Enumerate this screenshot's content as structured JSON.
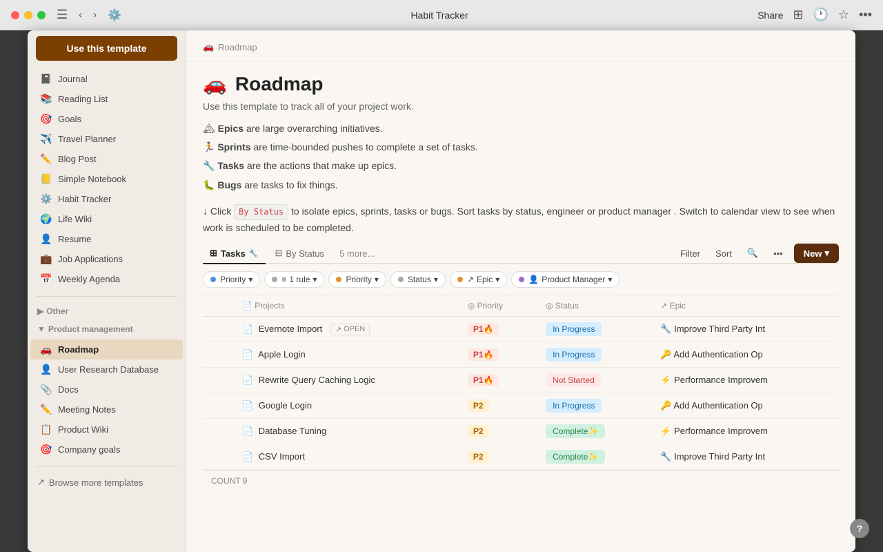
{
  "titlebar": {
    "title": "Habit Tracker",
    "share_label": "Share",
    "dots": [
      "red",
      "yellow",
      "green"
    ]
  },
  "use_template_btn": "Use this template",
  "breadcrumb": {
    "icon": "🚗",
    "label": "Roadmap"
  },
  "page": {
    "title": "Roadmap",
    "title_icon": "🚗",
    "description": "Use this template to track all of your project work.",
    "body_lines": [
      {
        "term": "Epics",
        "text": " are large overarching initiatives."
      },
      {
        "term": "Sprints",
        "text": " are time-bounded pushes to complete a set of tasks."
      },
      {
        "term": "Tasks",
        "text": " are the actions that make up epics."
      },
      {
        "term": "Bugs",
        "text": " are tasks to fix things."
      }
    ],
    "instruction": " Click ",
    "status_badge": "By Status",
    "instruction_after": " to isolate epics, sprints, tasks or bugs. Sort tasks by status, engineer or product manager . Switch to calendar view to see when work is scheduled to be completed."
  },
  "tabs": [
    {
      "label": "Tasks",
      "icon": "⊞",
      "active": true
    },
    {
      "label": "By Status",
      "icon": "⊟",
      "active": false
    }
  ],
  "tabs_more": "5 more...",
  "tabs_actions": {
    "filter": "Filter",
    "sort": "Sort",
    "search_icon": "🔍",
    "more_icon": "...",
    "new_btn": "New"
  },
  "filters": [
    {
      "label": "Priority",
      "icon": "↑",
      "type": "blue"
    },
    {
      "label": "1 rule",
      "icon": "≡",
      "type": "gray"
    },
    {
      "label": "Priority",
      "icon": "",
      "type": "orange"
    },
    {
      "label": "Status",
      "icon": "",
      "type": "gray"
    },
    {
      "label": "Epic",
      "icon": "↗",
      "type": "orange"
    },
    {
      "label": "Product Manager",
      "icon": "",
      "type": "purple"
    }
  ],
  "table": {
    "columns": [
      "",
      "Projects",
      "Priority",
      "Status",
      "Epic"
    ],
    "rows": [
      {
        "name": "Evernote Import",
        "badge": "OPEN",
        "priority": "P1🔥",
        "priority_class": "p1",
        "status": "In Progress",
        "status_class": "in-progress",
        "epic": "🔧 Improve Third Party Int"
      },
      {
        "name": "Apple Login",
        "badge": "",
        "priority": "P1🔥",
        "priority_class": "p1",
        "status": "In Progress",
        "status_class": "in-progress",
        "epic": "🔑 Add Authentication Op"
      },
      {
        "name": "Rewrite Query Caching Logic",
        "badge": "",
        "priority": "P1🔥",
        "priority_class": "p1",
        "status": "Not Started",
        "status_class": "not-started",
        "epic": "⚡ Performance Improvem"
      },
      {
        "name": "Google Login",
        "badge": "",
        "priority": "P2",
        "priority_class": "p2",
        "status": "In Progress",
        "status_class": "in-progress",
        "epic": "🔑 Add Authentication Op"
      },
      {
        "name": "Database Tuning",
        "badge": "",
        "priority": "P2",
        "priority_class": "p2",
        "status": "Complete✨",
        "status_class": "complete",
        "epic": "⚡ Performance Improvem"
      },
      {
        "name": "CSV Import",
        "badge": "",
        "priority": "P2",
        "priority_class": "p2",
        "status": "Complete✨",
        "status_class": "complete",
        "epic": "🔧 Improve Third Party Int"
      }
    ],
    "count_label": "COUNT",
    "count": "9"
  },
  "sidebar": {
    "items_top": [
      {
        "icon": "📓",
        "label": "Journal"
      },
      {
        "icon": "📚",
        "label": "Reading List"
      },
      {
        "icon": "🎯",
        "label": "Goals"
      },
      {
        "icon": "✈️",
        "label": "Travel Planner"
      },
      {
        "icon": "✏️",
        "label": "Blog Post"
      },
      {
        "icon": "📒",
        "label": "Simple Notebook"
      },
      {
        "icon": "⚙️",
        "label": "Habit Tracker"
      },
      {
        "icon": "🌍",
        "label": "Life Wiki"
      },
      {
        "icon": "👤",
        "label": "Resume"
      },
      {
        "icon": "💼",
        "label": "Job Applications"
      },
      {
        "icon": "📅",
        "label": "Weekly Agenda"
      }
    ],
    "other_section": "Other",
    "product_section": "Product management",
    "product_items": [
      {
        "icon": "🚗",
        "label": "Roadmap",
        "active": true
      },
      {
        "icon": "👤",
        "label": "User Research Database"
      },
      {
        "icon": "📎",
        "label": "Docs"
      },
      {
        "icon": "✏️",
        "label": "Meeting Notes"
      },
      {
        "icon": "📋",
        "label": "Product Wiki"
      },
      {
        "icon": "🎯",
        "label": "Company goals"
      }
    ],
    "browse_more": "Browse more templates"
  }
}
